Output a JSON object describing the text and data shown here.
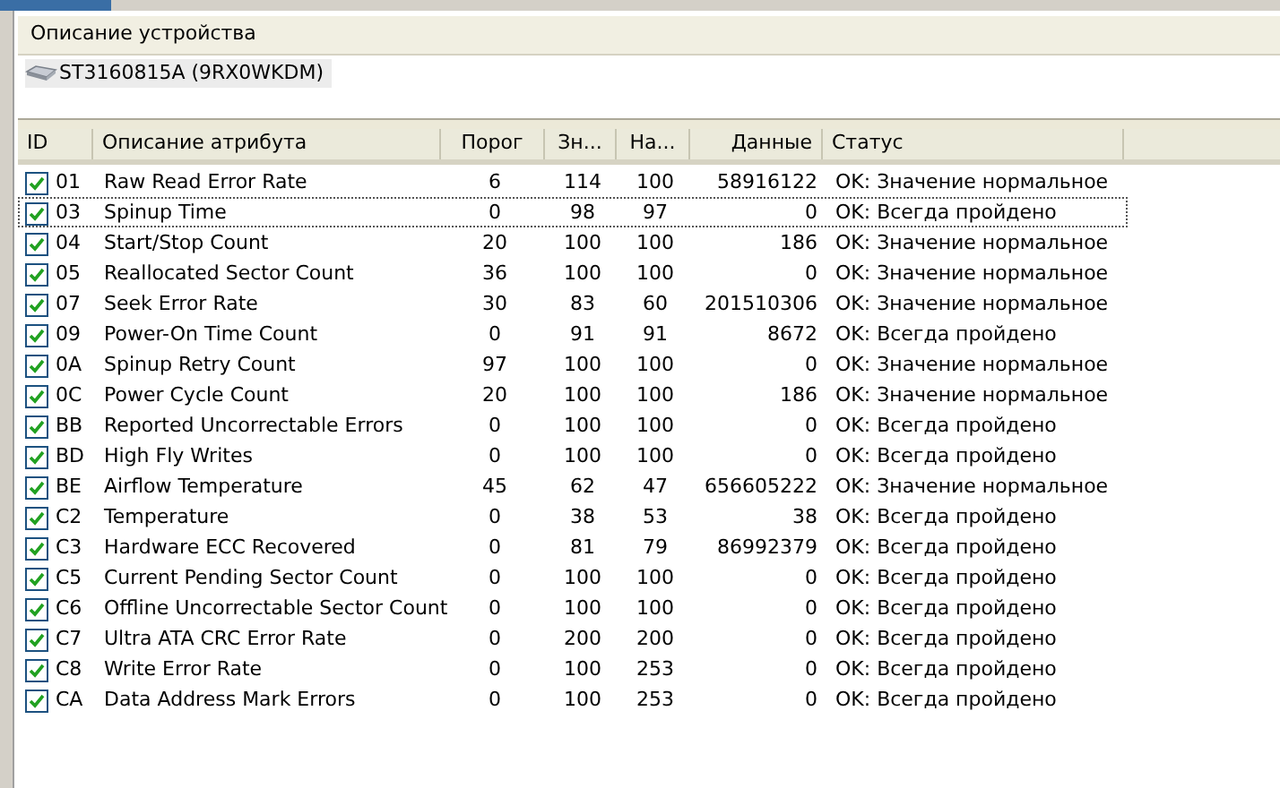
{
  "device_pane": {
    "header": "Описание устройства",
    "devices": [
      {
        "name": "ST3160815A (9RX0WKDM)",
        "selected": true
      }
    ]
  },
  "table": {
    "columns": [
      "ID",
      "Описание атрибута",
      "Порог",
      "Зн...",
      "На...",
      "Данные",
      "Статус"
    ],
    "rows": [
      {
        "checked": true,
        "focused": false,
        "id": "01",
        "name": "Raw Read Error Rate",
        "threshold": "6",
        "value": "114",
        "worst": "100",
        "data": "58916122",
        "status": "OK: Значение нормальное"
      },
      {
        "checked": true,
        "focused": true,
        "id": "03",
        "name": "Spinup Time",
        "threshold": "0",
        "value": "98",
        "worst": "97",
        "data": "0",
        "status": "OK: Всегда пройдено"
      },
      {
        "checked": true,
        "focused": false,
        "id": "04",
        "name": "Start/Stop Count",
        "threshold": "20",
        "value": "100",
        "worst": "100",
        "data": "186",
        "status": "OK: Значение нормальное"
      },
      {
        "checked": true,
        "focused": false,
        "id": "05",
        "name": "Reallocated Sector Count",
        "threshold": "36",
        "value": "100",
        "worst": "100",
        "data": "0",
        "status": "OK: Значение нормальное"
      },
      {
        "checked": true,
        "focused": false,
        "id": "07",
        "name": "Seek Error Rate",
        "threshold": "30",
        "value": "83",
        "worst": "60",
        "data": "201510306",
        "status": "OK: Значение нормальное"
      },
      {
        "checked": true,
        "focused": false,
        "id": "09",
        "name": "Power-On Time Count",
        "threshold": "0",
        "value": "91",
        "worst": "91",
        "data": "8672",
        "status": "OK: Всегда пройдено"
      },
      {
        "checked": true,
        "focused": false,
        "id": "0A",
        "name": "Spinup Retry Count",
        "threshold": "97",
        "value": "100",
        "worst": "100",
        "data": "0",
        "status": "OK: Значение нормальное"
      },
      {
        "checked": true,
        "focused": false,
        "id": "0C",
        "name": "Power Cycle Count",
        "threshold": "20",
        "value": "100",
        "worst": "100",
        "data": "186",
        "status": "OK: Значение нормальное"
      },
      {
        "checked": true,
        "focused": false,
        "id": "BB",
        "name": "Reported Uncorrectable Errors",
        "threshold": "0",
        "value": "100",
        "worst": "100",
        "data": "0",
        "status": "OK: Всегда пройдено"
      },
      {
        "checked": true,
        "focused": false,
        "id": "BD",
        "name": "High Fly Writes",
        "threshold": "0",
        "value": "100",
        "worst": "100",
        "data": "0",
        "status": "OK: Всегда пройдено"
      },
      {
        "checked": true,
        "focused": false,
        "id": "BE",
        "name": "Airflow Temperature",
        "threshold": "45",
        "value": "62",
        "worst": "47",
        "data": "656605222",
        "status": "OK: Значение нормальное"
      },
      {
        "checked": true,
        "focused": false,
        "id": "C2",
        "name": "Temperature",
        "threshold": "0",
        "value": "38",
        "worst": "53",
        "data": "38",
        "status": "OK: Всегда пройдено"
      },
      {
        "checked": true,
        "focused": false,
        "id": "C3",
        "name": "Hardware ECC Recovered",
        "threshold": "0",
        "value": "81",
        "worst": "79",
        "data": "86992379",
        "status": "OK: Всегда пройдено"
      },
      {
        "checked": true,
        "focused": false,
        "id": "C5",
        "name": "Current Pending Sector Count",
        "threshold": "0",
        "value": "100",
        "worst": "100",
        "data": "0",
        "status": "OK: Всегда пройдено"
      },
      {
        "checked": true,
        "focused": false,
        "id": "C6",
        "name": "Offline Uncorrectable Sector Count",
        "threshold": "0",
        "value": "100",
        "worst": "100",
        "data": "0",
        "status": "OK: Всегда пройдено"
      },
      {
        "checked": true,
        "focused": false,
        "id": "C7",
        "name": "Ultra ATA CRC Error Rate",
        "threshold": "0",
        "value": "200",
        "worst": "200",
        "data": "0",
        "status": "OK: Всегда пройдено"
      },
      {
        "checked": true,
        "focused": false,
        "id": "C8",
        "name": "Write Error Rate",
        "threshold": "0",
        "value": "100",
        "worst": "253",
        "data": "0",
        "status": "OK: Всегда пройдено"
      },
      {
        "checked": true,
        "focused": false,
        "id": "CA",
        "name": "Data Address Mark Errors",
        "threshold": "0",
        "value": "100",
        "worst": "253",
        "data": "0",
        "status": "OK: Всегда пройдено"
      }
    ]
  }
}
